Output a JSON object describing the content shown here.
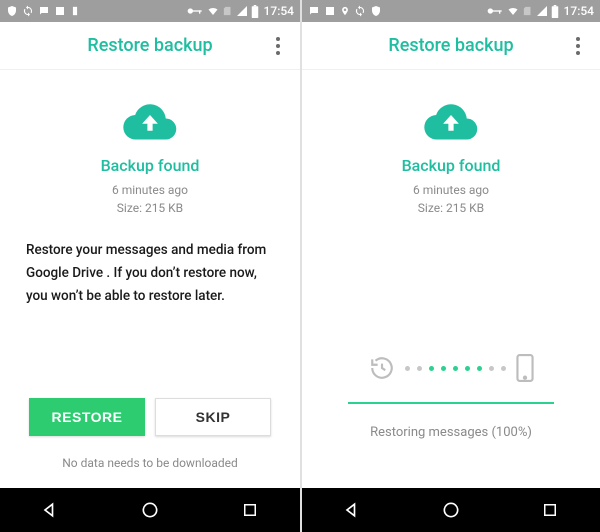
{
  "status": {
    "time": "17:54"
  },
  "left": {
    "title": "Restore backup",
    "heading": "Backup found",
    "time_ago": "6 minutes ago",
    "size": "Size: 215 KB",
    "description": "Restore your messages and media from Google Drive . If you don’t restore now, you won’t be able to restore later.",
    "restore_label": "RESTORE",
    "skip_label": "SKIP",
    "download_note": "No data needs to be downloaded"
  },
  "right": {
    "title": "Restore backup",
    "heading": "Backup found",
    "time_ago": "6 minutes ago",
    "size": "Size: 215 KB",
    "restoring": "Restoring messages (100%)"
  },
  "colors": {
    "accent": "#1fbea0",
    "primary_btn": "#2ecc71"
  }
}
